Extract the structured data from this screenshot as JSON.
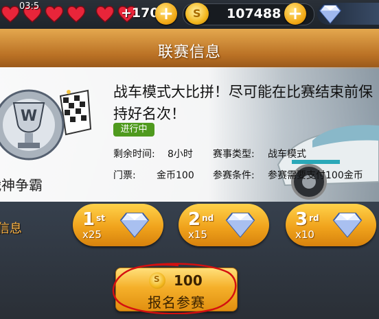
{
  "header": {
    "lives_timer": "03:5",
    "lives_extra": "+170",
    "coins": "107488"
  },
  "title": "联赛信息",
  "league": {
    "name": "战神争霸",
    "description": "战车模式大比拼！尽可能在比赛结束前保持好名次！",
    "status": "进行中",
    "remaining_label": "剩余时间:",
    "remaining_value": "8小时",
    "type_label": "赛事类型:",
    "type_value": "战车模式",
    "ticket_label": "门票:",
    "ticket_value": "金币100",
    "condition_label": "参赛条件:",
    "condition_value": "参赛需要支付100金币"
  },
  "rewards_label": "信息",
  "rewards": [
    {
      "rank": "1",
      "suffix": "st",
      "amount": "x25"
    },
    {
      "rank": "2",
      "suffix": "nd",
      "amount": "x15"
    },
    {
      "rank": "3",
      "suffix": "rd",
      "amount": "x10"
    }
  ],
  "signup": {
    "cost": "100",
    "label": "报名参赛"
  },
  "colors": {
    "title_bar": "#c9822f",
    "status_green": "#4f9a1e",
    "gold": "#f5b02a",
    "annotation": "#d41010"
  }
}
